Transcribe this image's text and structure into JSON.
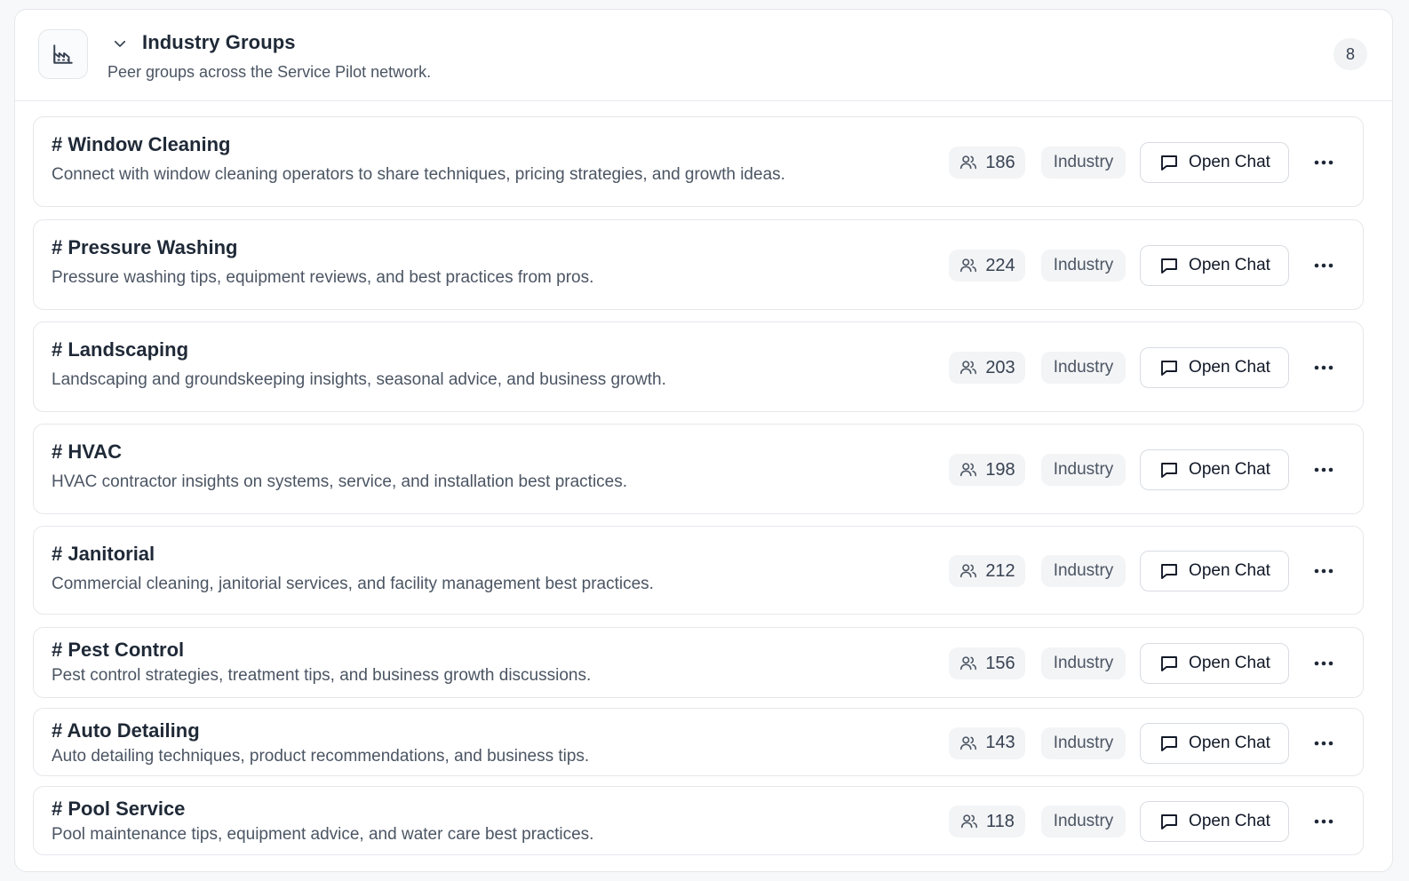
{
  "header": {
    "title": "Industry Groups",
    "subtitle": "Peer groups across the Service Pilot network.",
    "count": "8",
    "icon": "factory-icon",
    "toggle_icon": "chevron-down-icon"
  },
  "groups": [
    {
      "name": "# Window Cleaning",
      "description": "Connect with window cleaning operators to share techniques, pricing strategies, and growth ideas.",
      "members": "186",
      "tag": "Industry",
      "action": "Open Chat"
    },
    {
      "name": "# Pressure Washing",
      "description": "Pressure washing tips, equipment reviews, and best practices from pros.",
      "members": "224",
      "tag": "Industry",
      "action": "Open Chat"
    },
    {
      "name": "# Landscaping",
      "description": "Landscaping and groundskeeping insights, seasonal advice, and business growth.",
      "members": "203",
      "tag": "Industry",
      "action": "Open Chat"
    },
    {
      "name": "# HVAC",
      "description": "HVAC contractor insights on systems, service, and installation best practices.",
      "members": "198",
      "tag": "Industry",
      "action": "Open Chat"
    },
    {
      "name": "# Janitorial",
      "description": "Commercial cleaning, janitorial services, and facility management best practices.",
      "members": "212",
      "tag": "Industry",
      "action": "Open Chat"
    },
    {
      "name": "# Pest Control",
      "description": "Pest control strategies, treatment tips, and business growth discussions.",
      "members": "156",
      "tag": "Industry",
      "action": "Open Chat"
    },
    {
      "name": "# Auto Detailing",
      "description": "Auto detailing techniques, product recommendations, and business tips.",
      "members": "143",
      "tag": "Industry",
      "action": "Open Chat"
    },
    {
      "name": "# Pool Service",
      "description": "Pool maintenance tips, equipment advice, and water care best practices.",
      "members": "118",
      "tag": "Industry",
      "action": "Open Chat"
    }
  ]
}
